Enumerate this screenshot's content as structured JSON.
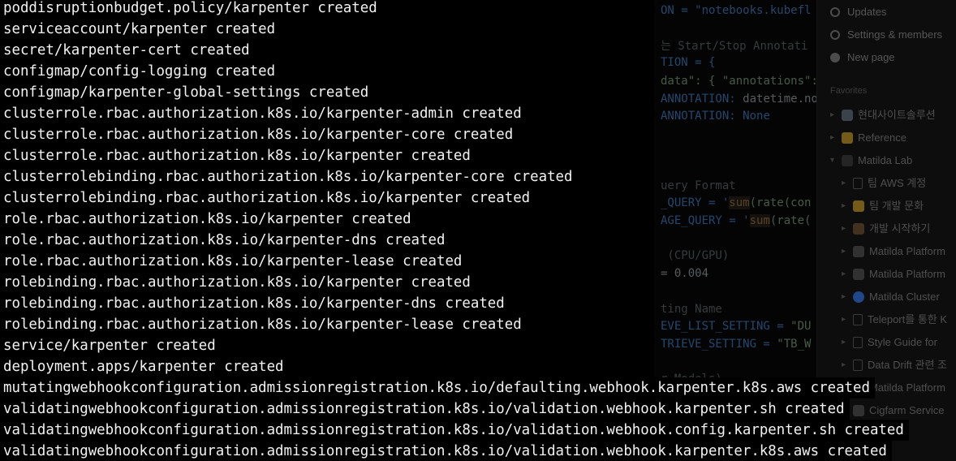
{
  "terminal": {
    "lines": [
      "poddisruptionbudget.policy/karpenter created",
      "serviceaccount/karpenter created",
      "secret/karpenter-cert created",
      "configmap/config-logging created",
      "configmap/karpenter-global-settings created",
      "clusterrole.rbac.authorization.k8s.io/karpenter-admin created",
      "clusterrole.rbac.authorization.k8s.io/karpenter-core created",
      "clusterrole.rbac.authorization.k8s.io/karpenter created",
      "clusterrolebinding.rbac.authorization.k8s.io/karpenter-core created",
      "clusterrolebinding.rbac.authorization.k8s.io/karpenter created",
      "role.rbac.authorization.k8s.io/karpenter created",
      "role.rbac.authorization.k8s.io/karpenter-dns created",
      "role.rbac.authorization.k8s.io/karpenter-lease created",
      "rolebinding.rbac.authorization.k8s.io/karpenter created",
      "rolebinding.rbac.authorization.k8s.io/karpenter-dns created",
      "rolebinding.rbac.authorization.k8s.io/karpenter-lease created",
      "service/karpenter created",
      "deployment.apps/karpenter created",
      "mutatingwebhookconfiguration.admissionregistration.k8s.io/defaulting.webhook.karpenter.k8s.aws created",
      "validatingwebhookconfiguration.admissionregistration.k8s.io/validation.webhook.karpenter.sh created",
      "validatingwebhookconfiguration.admissionregistration.k8s.io/validation.webhook.config.karpenter.sh created",
      "validatingwebhookconfiguration.admissionregistration.k8s.io/validation.webhook.karpenter.k8s.aws created"
    ]
  },
  "editor": {
    "line_1": "ON = \"notebooks.kubefl",
    "line_2": "는 Start/Stop Annotati",
    "line_3": "TION = {",
    "line_4a": "data\": {",
    "line_4b": "\"annotations\":",
    "line_5a": "ANNOTATION: ",
    "line_5b": "datetime.no",
    "line_6a": "ANNOTATION: ",
    "line_6b": "None",
    "line_7": "uery Format",
    "line_8a": "_QUERY = '",
    "line_8b": "sum",
    "line_8c": "(rate(con",
    "line_9a": "AGE_QUERY = '",
    "line_9b": "sum",
    "line_9c": "(rate(",
    "line_10": " (CPU/GPU)",
    "line_11": "= 0.004",
    "line_12": "ting Name",
    "line_13a": "EVE_LIST_SETTING = ",
    "line_13b": "\"DU",
    "line_14a": "TRIEVE_SETTING = ",
    "line_14b": "\"TB_W",
    "line_15": "r Models)"
  },
  "sidebar": {
    "top_items": [
      "Updates",
      "Settings & members",
      "New page"
    ],
    "section_label": "Favorites",
    "items": [
      "현대사이트솔루션",
      "Reference",
      "Matilda Lab",
      "팀 AWS 계정",
      "팀 개발 문화",
      "개발 시작하기",
      "Matilda Platform",
      "Matilda Platform",
      "Matilda Cluster",
      "Teleport를 통한 K",
      "Style Guide for",
      "Data Drift 관련 조",
      "Matilda Platform",
      "Cigfarm Service"
    ],
    "colors": {
      "accent_orange": "#e08a2e",
      "accent_blue": "#3b82f6",
      "accent_yellow": "#d4a72c"
    }
  }
}
